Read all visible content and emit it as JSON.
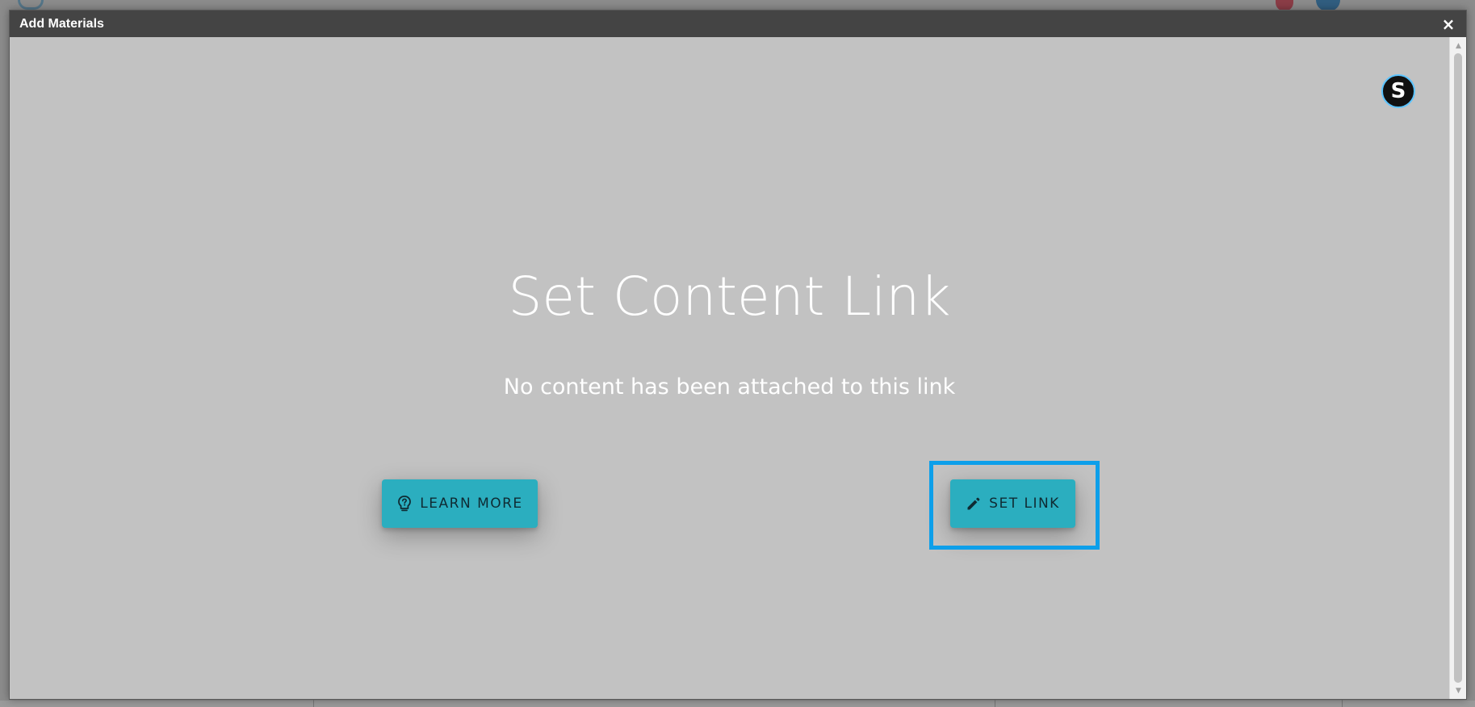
{
  "modal": {
    "title": "Add Materials",
    "close_label": "×"
  },
  "badge": {
    "letter": "S",
    "icon": "s-circle-icon",
    "border_color": "#5cc4ff"
  },
  "content": {
    "title": "Set Content Link",
    "subtitle": "No content has been attached to this link"
  },
  "buttons": {
    "learn_more": {
      "label": "LEARN MORE",
      "icon": "lightbulb-question-icon"
    },
    "set_link": {
      "label": "SET LINK",
      "icon": "pencil-icon"
    }
  },
  "colors": {
    "titlebar": "#444444",
    "modal_background": "#c2c2c2",
    "button_accent": "#2baebf",
    "highlight": "#0d9fea"
  }
}
